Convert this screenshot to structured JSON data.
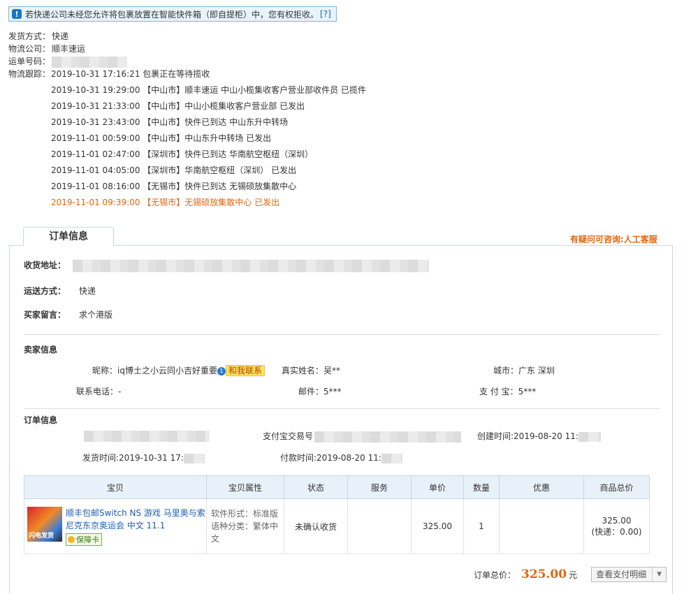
{
  "notice": {
    "text": "若快递公司未经您允许将包裹放置在智能快件箱（即自提柜）中，您有权拒收。",
    "link": "[?]"
  },
  "shipping": {
    "method_label": "发货方式：",
    "method": "快递",
    "company_label": "物流公司：",
    "company": "顺丰速运",
    "tracking_label": "运单号码：",
    "trace_label": "物流跟踪："
  },
  "tracking": [
    {
      "time": "2019-10-31 17:16:21",
      "text": "包裹正在等待揽收"
    },
    {
      "time": "2019-10-31 19:29:00",
      "text": "【中山市】顺丰速运 中山小榄集收客户营业部收件员 已揽件"
    },
    {
      "time": "2019-10-31 21:33:00",
      "text": "【中山市】中山小榄集收客户营业部 已发出"
    },
    {
      "time": "2019-10-31 23:43:00",
      "text": "【中山市】快件已到达 中山东升中转场"
    },
    {
      "time": "2019-11-01 00:59:00",
      "text": "【中山市】中山东升中转场 已发出"
    },
    {
      "time": "2019-11-01 02:47:00",
      "text": "【深圳市】快件已到达 华南航空枢纽（深圳）"
    },
    {
      "time": "2019-11-01 04:05:00",
      "text": "【深圳市】华南航空枢纽（深圳） 已发出"
    },
    {
      "time": "2019-11-01 08:16:00",
      "text": "【无锡市】快件已到达 无锡硕放集散中心"
    },
    {
      "time": "2019-11-01 09:39:00",
      "text": "【无锡市】无锡硕放集散中心 已发出"
    }
  ],
  "order": {
    "tab_label": "订单信息",
    "help_link": "有疑问可咨询:人工客服",
    "address_label": "收货地址：",
    "delivery_label": "运送方式：",
    "delivery": "快递",
    "message_label": "买家留言：",
    "message": "求个港版",
    "seller_section": "卖家信息",
    "nickname_label": "昵称：",
    "nickname": "iq博士之小云同小吉好重要",
    "badge": "1",
    "contact": "和我联系",
    "realname_label": "真实姓名：",
    "realname": "吴**",
    "city_label": "城市：",
    "city": "广东 深圳",
    "phone_label": "联系电话：",
    "phone": "-",
    "email_label": "邮件：",
    "email": "5***",
    "alipay_label": "支 付 宝：",
    "alipay": "5***",
    "order_section": "订单信息",
    "trade_label": "支付宝交易号",
    "created_label": "创建时间:",
    "created": "2019-08-20 11:",
    "shipped_label": "发货时间:",
    "shipped": "2019-10-31 17:",
    "paid_label": "付款时间:",
    "paid": "2019-08-20 11:"
  },
  "table": {
    "headers": [
      "宝贝",
      "宝贝属性",
      "状态",
      "服务",
      "单价",
      "数量",
      "优惠",
      "商品总价"
    ],
    "item": {
      "title": "顺丰包邮Switch NS 游戏 马里奥与索尼克东京奥运会 中文 11.1",
      "thumb_text": "闪电发货",
      "guarantee": "保障卡",
      "attr1": "软件形式：标准版",
      "attr2": "语种分类：繁体中文",
      "status": "未确认收货",
      "price": "325.00",
      "qty": "1",
      "total": "325.00",
      "shipping_fee": "(快递：0.00)"
    }
  },
  "summary": {
    "label": "订单总价：",
    "amount": "325.00",
    "unit": "元",
    "button": "查看支付明细"
  }
}
